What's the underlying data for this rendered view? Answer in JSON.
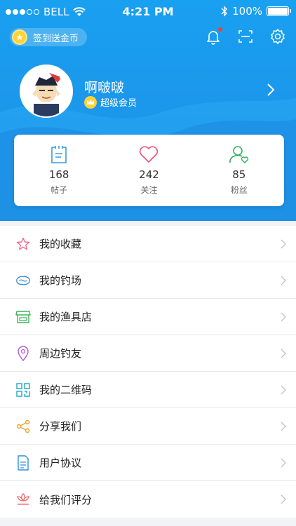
{
  "status_bar": {
    "carrier": "BELL",
    "time": "4:21 PM",
    "battery": "100%",
    "battery_level": 1.0
  },
  "header": {
    "checkin_label": "签到送金币",
    "username": "啊啵啵",
    "membership": "超级会员"
  },
  "stats": [
    {
      "value": "168",
      "label": "帖子"
    },
    {
      "value": "242",
      "label": "关注"
    },
    {
      "value": "85",
      "label": "粉丝"
    }
  ],
  "menu": [
    {
      "label": "我的收藏",
      "icon": "star-icon"
    },
    {
      "label": "我的钓场",
      "icon": "lake-icon"
    },
    {
      "label": "我的渔具店",
      "icon": "shop-icon"
    },
    {
      "label": "周边钓友",
      "icon": "location-pin-icon"
    },
    {
      "label": "我的二维码",
      "icon": "qr-code-icon"
    },
    {
      "label": "分享我们",
      "icon": "share-icon"
    },
    {
      "label": "用户协议",
      "icon": "document-icon"
    },
    {
      "label": "给我们评分",
      "icon": "rating-icon"
    }
  ],
  "colors": {
    "header": "#1c95ea",
    "star": "#f06b8c",
    "lake": "#2e8ad6",
    "shop": "#3cb45a",
    "pin": "#b05bd6",
    "qr": "#1aa9c9",
    "share": "#f0a030",
    "doc": "#2f8fe0",
    "rating": "#f06b6b"
  }
}
